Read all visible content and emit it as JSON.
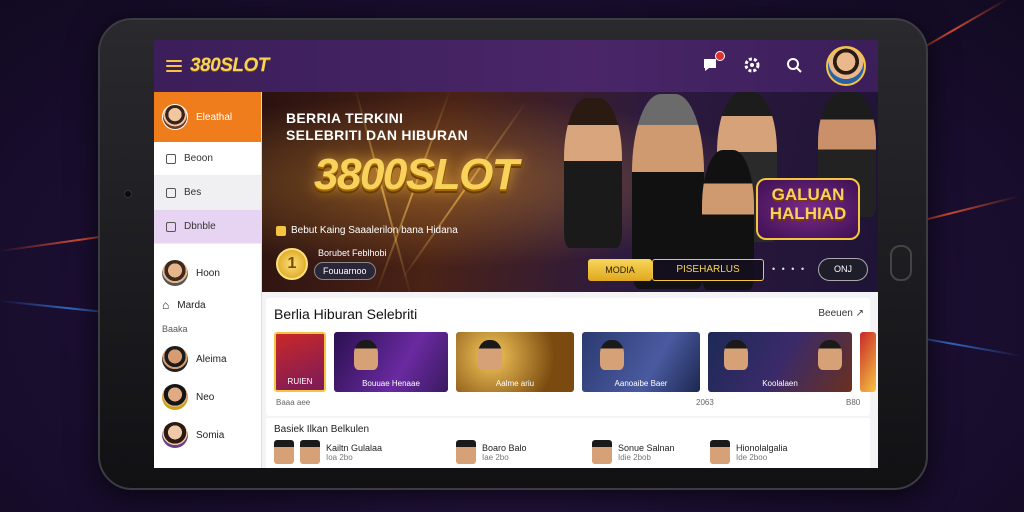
{
  "app": {
    "logo": "380SLOT"
  },
  "sidebar": {
    "top_label": "Eleathal",
    "items": [
      {
        "label": "Beoon"
      },
      {
        "label": "Bes"
      },
      {
        "label": "Dbnble"
      }
    ],
    "nav": [
      {
        "label": "Hoon"
      },
      {
        "label": "Marda"
      }
    ],
    "section_label": "Baaka",
    "people": [
      {
        "name": "Aleima"
      },
      {
        "name": "Neo"
      },
      {
        "name": "Somia"
      }
    ]
  },
  "hero": {
    "title_line1": "BERRIA TERKINI",
    "title_line2": "SELEBRITI DAN HIBURAN",
    "logo": "3800SLOT",
    "subtitle": "Bebut Kaing Saaalerilon bana Hidana",
    "coin_glyph": "1",
    "small_text": "Borubet Feblhobi",
    "pill_label": "Fouuarnoo",
    "badge_line1": "GALUAN",
    "badge_line2": "HALHIAD",
    "btn_yellow": "MODIA",
    "btn_dark": "PISEHARLUS",
    "dots": "• • • •",
    "btn_round": "ONJ"
  },
  "section": {
    "title": "Berlia Hiburan Selebriti",
    "see_all": "Beeuen",
    "thumbs": [
      {
        "caption": "RUIEN"
      },
      {
        "caption": "Bouuae Henaae"
      },
      {
        "caption": "Aalme ariu"
      },
      {
        "caption": "Aanoaibe Baer"
      },
      {
        "caption": "Koolalaen"
      }
    ],
    "meta_left": "Baaa aee",
    "meta_mid": "2063",
    "meta_right": "B80"
  },
  "section2": {
    "title": "Basiek Ilkan Belkulen",
    "items": [
      {
        "title": "Kailtn Gulalaa",
        "sub": "Ioa 2bo"
      },
      {
        "title": "Boaro Balo",
        "sub": "Iae 2bo"
      },
      {
        "title": "Sonue Salnan",
        "sub": "Idie 2bob"
      },
      {
        "title": "Hionolalgalia",
        "sub": "Ide 2boo"
      }
    ]
  },
  "colors": {
    "accent": "#f5c542",
    "topbar": "#4a2668",
    "sidebar_highlight": "#f07d1c",
    "notification": "#e23030"
  },
  "icons": [
    "menu-icon",
    "chat-icon",
    "settings-icon",
    "search-icon",
    "user-avatar"
  ]
}
